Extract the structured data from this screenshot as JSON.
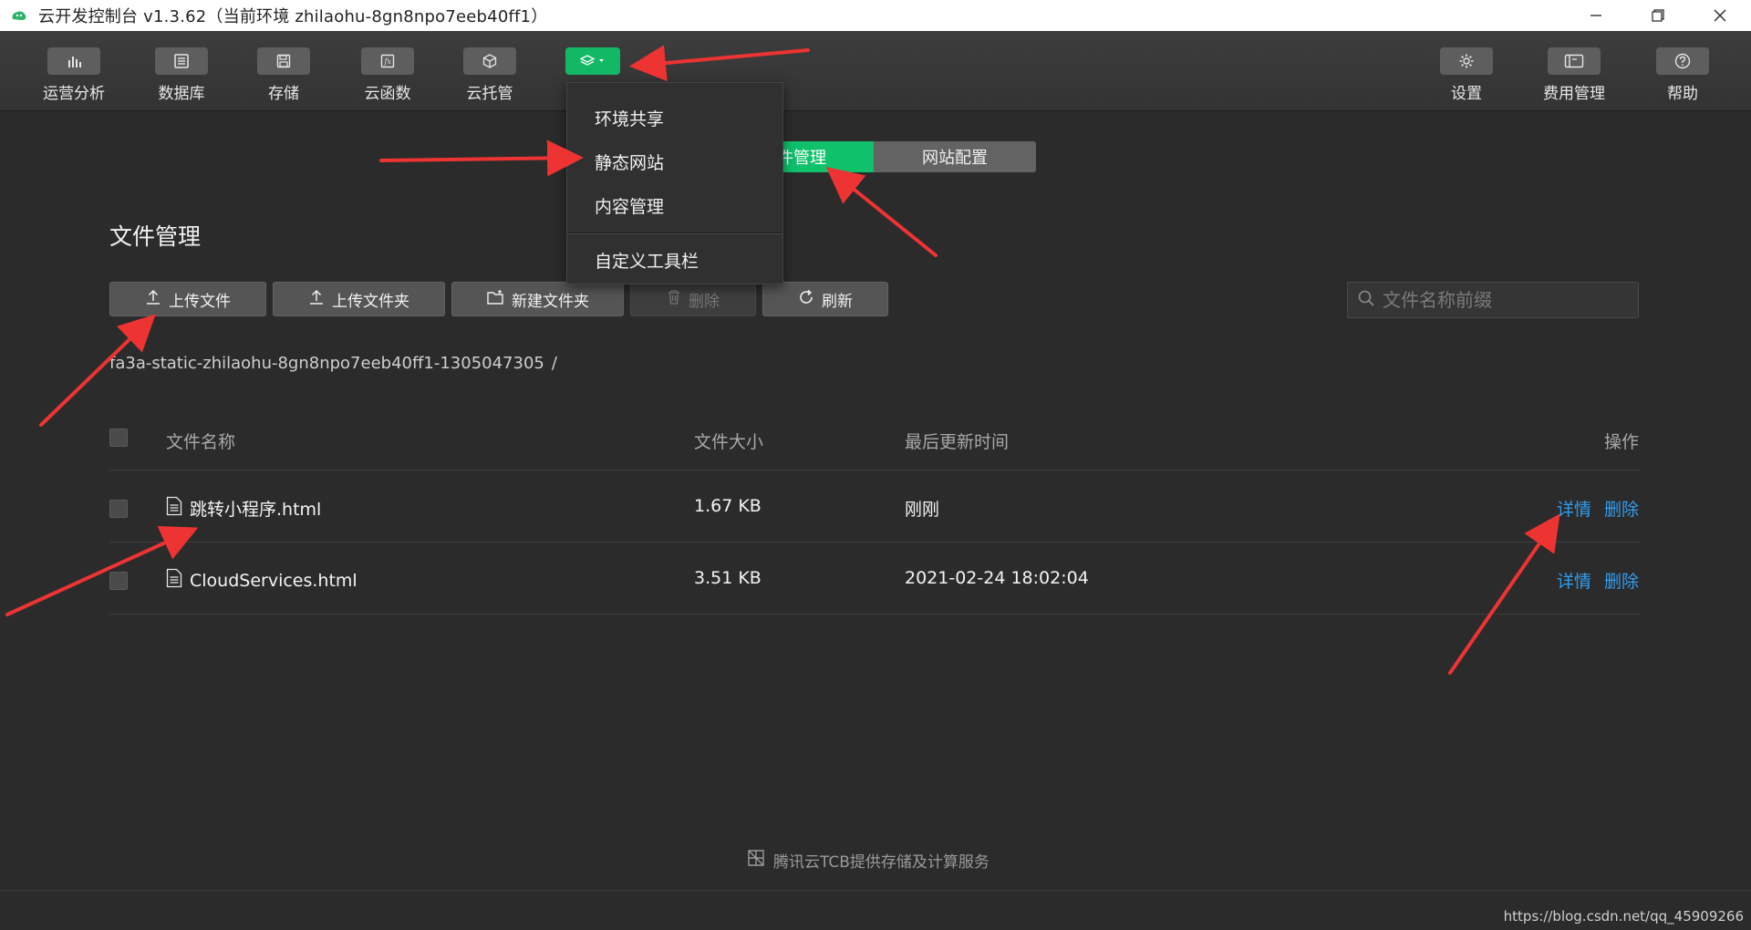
{
  "window": {
    "title": "云开发控制台 v1.3.62（当前环境 zhilaohu-8gn8npo7eeb40ff1）"
  },
  "toolbar": {
    "left_tools": [
      {
        "label": "运营分析",
        "icon": "bar-chart-icon"
      },
      {
        "label": "数据库",
        "icon": "database-icon"
      },
      {
        "label": "存储",
        "icon": "save-icon"
      },
      {
        "label": "云函数",
        "icon": "function-icon"
      },
      {
        "label": "云托管",
        "icon": "cube-icon"
      }
    ],
    "more_icon": "layers-icon",
    "right_tools": [
      {
        "label": "设置",
        "icon": "gear-icon"
      },
      {
        "label": "费用管理",
        "icon": "wallet-icon"
      },
      {
        "label": "帮助",
        "icon": "question-icon"
      }
    ]
  },
  "dropdown": {
    "items": [
      "环境共享",
      "静态网站",
      "内容管理"
    ],
    "custom": "自定义工具栏"
  },
  "tabs": {
    "active": "件管理",
    "inactive": "网站配置"
  },
  "page": {
    "title": "文件管理"
  },
  "actions": {
    "upload_file": "上传文件",
    "upload_folder": "上传文件夹",
    "new_folder": "新建文件夹",
    "delete": "删除",
    "refresh": "刷新"
  },
  "search": {
    "placeholder": "文件名称前缀"
  },
  "path": {
    "bucket": "fa3a-static-zhilaohu-8gn8npo7eeb40ff1-1305047305",
    "separator": "/"
  },
  "table": {
    "headers": {
      "name": "文件名称",
      "size": "文件大小",
      "updated": "最后更新时间",
      "ops": "操作"
    },
    "rows": [
      {
        "name": "跳转小程序.html",
        "size": "1.67 KB",
        "updated": "刚刚",
        "detail": "详情",
        "delete": "删除"
      },
      {
        "name": "CloudServices.html",
        "size": "3.51 KB",
        "updated": "2021-02-24 18:02:04",
        "detail": "详情",
        "delete": "删除"
      }
    ]
  },
  "footer": {
    "text": "腾讯云TCB提供存储及计算服务"
  },
  "watermark": "https://blog.csdn.net/qq_45909266",
  "colors": {
    "accent_green": "#0fc16b",
    "link_blue": "#2f9ef2",
    "annotation_red": "#ee3333"
  }
}
